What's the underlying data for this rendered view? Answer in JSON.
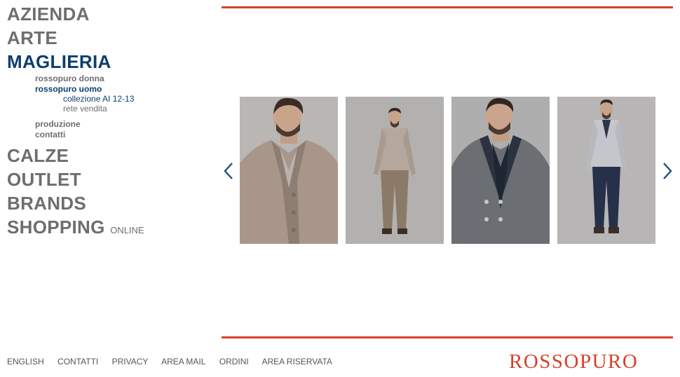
{
  "nav": {
    "main_items": [
      {
        "label": "AZIENDA"
      },
      {
        "label": "ARTE"
      },
      {
        "label": "MAGLIERIA"
      },
      {
        "label": "CALZE"
      },
      {
        "label": "OUTLET"
      },
      {
        "label": "BRANDS"
      },
      {
        "label": "SHOPPING",
        "suffix": "ONLINE"
      }
    ],
    "maglieria_sub": [
      {
        "label": "rossopuro donna"
      },
      {
        "label": "rossopuro uomo"
      },
      {
        "label": "produzione"
      },
      {
        "label": "contatti"
      }
    ],
    "uomo_sub": [
      {
        "label": "collezione AI 12-13"
      },
      {
        "label": "rete vendita"
      }
    ]
  },
  "gallery": {
    "prev_icon": "chevron-left-icon",
    "next_icon": "chevron-right-icon",
    "photos": [
      {
        "name": "photo-beige-cardigan-closeup"
      },
      {
        "name": "photo-beige-cardigan-full"
      },
      {
        "name": "photo-grey-jacket-scarf"
      },
      {
        "name": "photo-grey-cardigan-full"
      }
    ]
  },
  "footer": {
    "links": [
      "ENGLISH",
      "CONTATTI",
      "PRIVACY",
      "AREA MAIL",
      "ORDINI",
      "AREA RISERVATA"
    ]
  },
  "brand": {
    "logo_text": "ROSSOPURO"
  },
  "colors": {
    "accent_red": "#d6422b",
    "nav_active_blue": "#0d3f6e",
    "nav_grey": "#6e6e6e",
    "arrow_blue": "#1d4f7f"
  }
}
